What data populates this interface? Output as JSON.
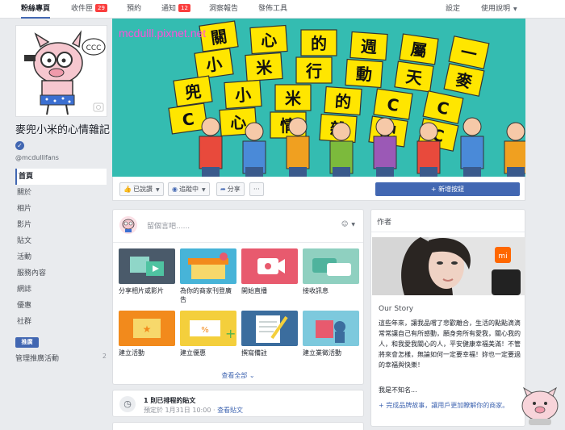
{
  "topbar": {
    "tabs": [
      {
        "label": "粉絲專頁",
        "active": true
      },
      {
        "label": "收件匣",
        "badge": "29"
      },
      {
        "label": "預約"
      },
      {
        "label": "通知",
        "badge": "12"
      },
      {
        "label": "洞察報告"
      },
      {
        "label": "發佈工具"
      }
    ],
    "settings": "設定",
    "help": "使用說明"
  },
  "sidebar": {
    "page_name": "麥兜小米的心情雜記",
    "handle": "@mcdulllfans",
    "nav": [
      "首頁",
      "關於",
      "相片",
      "影片",
      "貼文",
      "活動",
      "服務內容",
      "網誌",
      "優惠",
      "社群"
    ],
    "promote": "推廣",
    "manage_label": "管理推廣活動",
    "manage_count": "2",
    "avatar_bubble": "CCC"
  },
  "cover": {
    "watermark": "mcdulll.pixnet.net",
    "sign_chars": [
      "關",
      "心",
      "的",
      "週",
      "屬",
      "一",
      "小",
      "米",
      "行",
      "動",
      "天",
      "麥",
      "兜",
      "小",
      "米",
      "的",
      "C",
      "C",
      "C",
      "心",
      "情",
      "雜",
      "記",
      "C"
    ]
  },
  "actions": {
    "liked": "已說讚",
    "following": "追蹤中",
    "share": "分享",
    "more": "···",
    "add_button": "+ 新增按鈕"
  },
  "composer": {
    "placeholder": "留個言吧......",
    "tiles": [
      {
        "label": "分享相片或影片",
        "color": "#4a5a6a"
      },
      {
        "label": "為你的商家刊登廣告",
        "color": "#47b4d8"
      },
      {
        "label": "開始直播",
        "color": "#e85a6e"
      },
      {
        "label": "接收訊息",
        "color": "#8fd0c0"
      },
      {
        "label": "建立活動",
        "color": "#f28a1c"
      },
      {
        "label": "建立優惠",
        "color": "#f4cf3c"
      },
      {
        "label": "撰寫備註",
        "color": "#3b6d9e"
      },
      {
        "label": "建立業徵活動",
        "color": "#7dc9dd"
      }
    ],
    "see_all": "查看全部"
  },
  "scheduled": {
    "title": "1 則已排程的貼文",
    "meta": "預定於 1月31日 10:00",
    "link": "查看貼文"
  },
  "author": {
    "heading": "作者",
    "story_title": "Our Story",
    "story_text": "這些年來，讓我品嚐了悲歡離合，生活的點點滴滴常常讓自己有所感動，願身旁所有愛我，關心我的人，和我愛我關心的人，平安健康幸福美滿！不管將來會怎樣，無論如何一定要幸福！妳也一定要過的幸福與快樂！",
    "story_sign": "我是不知名...",
    "story_link": "+ 完成品牌故事，讓用戶更加瞭解你的商家。",
    "logo_text": "mi"
  }
}
